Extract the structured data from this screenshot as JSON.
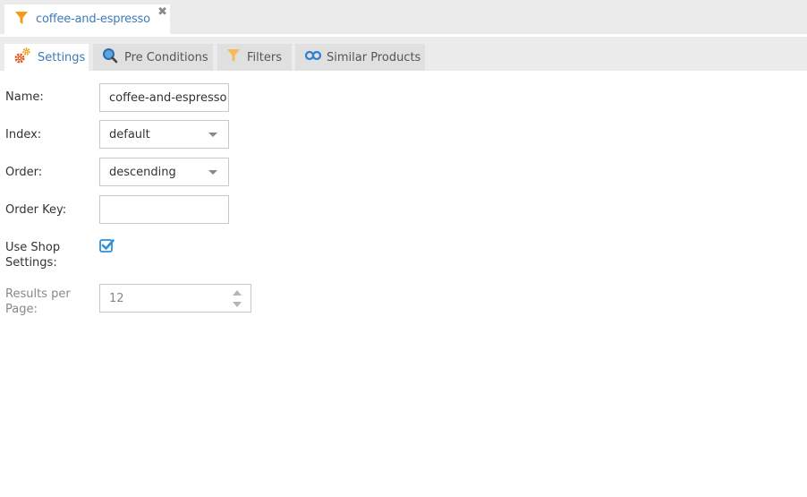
{
  "document_tab": {
    "icon": "filter-icon",
    "title": "coffee-and-espresso",
    "close_icon": "close-icon",
    "colors": {
      "icon": "#f39c12",
      "title": "#3d7bb8"
    }
  },
  "tabs": [
    {
      "label": "Settings",
      "icon": "gears-icon",
      "active": true
    },
    {
      "label": "Pre Conditions",
      "icon": "magnifier-icon",
      "active": false
    },
    {
      "label": "Filters",
      "icon": "filter-icon",
      "active": false
    },
    {
      "label": "Similar Products",
      "icon": "link-icon",
      "active": false
    }
  ],
  "form": {
    "name": {
      "label": "Name:",
      "value": "coffee-and-espresso"
    },
    "index": {
      "label": "Index:",
      "value": "default"
    },
    "order": {
      "label": "Order:",
      "value": "descending"
    },
    "order_key": {
      "label": "Order Key:",
      "value": ""
    },
    "use_shop_settings": {
      "label_line1": "Use Shop",
      "label_line2": "Settings:",
      "checked": true
    },
    "results_per_page": {
      "label_line1": "Results per",
      "label_line2": "Page:",
      "value": "12",
      "disabled": true
    }
  },
  "colors": {
    "accent": "#3d7bb8",
    "checkbox": "#2f8fd8",
    "orange": "#f39c12",
    "gear_red": "#e0541b"
  }
}
